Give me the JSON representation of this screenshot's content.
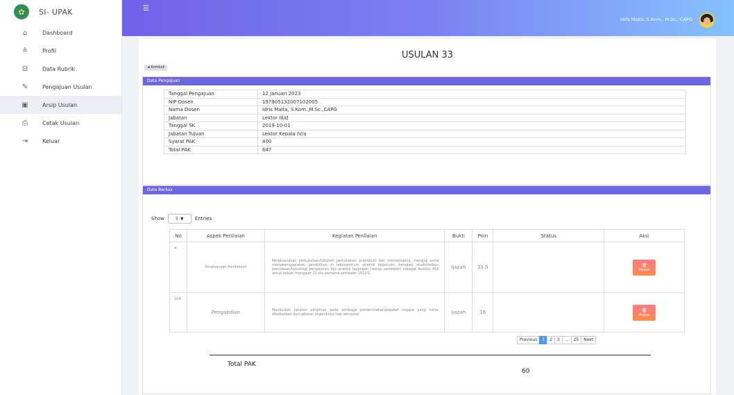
{
  "app": {
    "name": "SI- UPAK"
  },
  "sidebar": {
    "items": [
      {
        "label": "Dashboard",
        "icon": "home-icon"
      },
      {
        "label": "Profil",
        "icon": "profile-icon"
      },
      {
        "label": "Data Rubrik",
        "icon": "rubric-icon"
      },
      {
        "label": "Pengajuan Usulan",
        "icon": "edit-icon"
      },
      {
        "label": "Arsip Usulan",
        "icon": "archive-icon"
      },
      {
        "label": "Cetak Usulan",
        "icon": "print-icon"
      },
      {
        "label": "Keluar",
        "icon": "logout-icon"
      }
    ],
    "active_index": 4
  },
  "topbar": {
    "user_name": "Idris Maita, S.Kom., M.Sc., CAPG"
  },
  "page": {
    "title": "USULAN 33",
    "back_label": "◄ Kembali"
  },
  "pengajuan": {
    "header": "Data Pengajuan",
    "rows": [
      {
        "k": "Tanggal Pengajuan",
        "v": "12 Januari 2023"
      },
      {
        "k": "NIP Dosen",
        "v": "197905132007102005"
      },
      {
        "k": "Nama Dosen",
        "v": "Idris Maita, S.Kom.,M.Sc.,CAPG"
      },
      {
        "k": "Jabatan",
        "v": "Lektor III/d"
      },
      {
        "k": "Tanggal SK",
        "v": "2019-10-01"
      },
      {
        "k": "Jabatan Tujuan",
        "v": "Lektor Kepala IV/a"
      },
      {
        "k": "Syarat PAK",
        "v": "400"
      },
      {
        "k": "Total PAK",
        "v": "647"
      }
    ]
  },
  "berkas": {
    "header": "Data Berkas",
    "show_label": "Show",
    "show_value": "5",
    "entries_label": "Entries",
    "columns": [
      "No",
      "Aspek Penilaian",
      "Kegiatan Penilaian",
      "Bukti",
      "Poin",
      "Status",
      "Aksi"
    ],
    "rows": [
      {
        "no": "4",
        "aspek": "Pelaksanaan Pendidikan",
        "kegiatan": "Melaksanakan perkuliahan/tutorial/ perkuliahan praktikum dan membimbing, menguji serta menyelenggarakan pendidikan di laboratorium, praktik keguruan, bengkel/ studio/kebun percobaan/teknologi pengajaran dan praktik lapangan (setiap semester) sebagai Asisten Ahli untuk beban mengajar 10 sks pertama semester 2022/1",
        "bukti": "Ijazah",
        "poin": "33.5",
        "status": "",
        "aksi": "Hapus"
      },
      {
        "no": "104",
        "aspek": "Pengabdian",
        "kegiatan": "Menduduki jabatan pimpinan pada lembaga pemerintahan/pejabat negara yang harus dibebaskan dari jabatan organiknya tiap semester",
        "bukti": "Ijazah",
        "poin": "16",
        "status": "",
        "aksi": "Hapus"
      }
    ],
    "pagination": {
      "previous": "Previous",
      "pages": [
        "1",
        "2",
        "3",
        "...",
        "25"
      ],
      "next": "Next",
      "active": "1"
    },
    "total_label": "Total PAK",
    "total_value": "60"
  }
}
